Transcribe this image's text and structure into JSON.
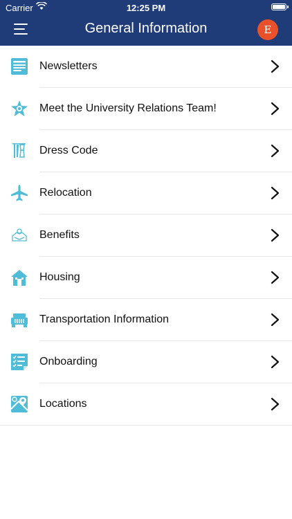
{
  "status_bar": {
    "carrier": "Carrier",
    "time": "12:25 PM"
  },
  "header": {
    "title": "General Information",
    "avatar_initial": "E"
  },
  "colors": {
    "nav_bar": "#1f3b78",
    "icon_teal": "#4fbcd8",
    "avatar": "#e8512a"
  },
  "items": [
    {
      "label": "Newsletters",
      "icon": "newsletter-icon"
    },
    {
      "label": "Meet the University Relations Team!",
      "icon": "star-badge-icon"
    },
    {
      "label": "Dress Code",
      "icon": "clothes-hanger-icon"
    },
    {
      "label": "Relocation",
      "icon": "airplane-icon"
    },
    {
      "label": "Benefits",
      "icon": "benefits-hand-icon"
    },
    {
      "label": "Housing",
      "icon": "house-icon"
    },
    {
      "label": "Transportation Information",
      "icon": "jeep-icon"
    },
    {
      "label": "Onboarding",
      "icon": "checklist-icon"
    },
    {
      "label": "Locations",
      "icon": "map-pin-icon"
    }
  ]
}
